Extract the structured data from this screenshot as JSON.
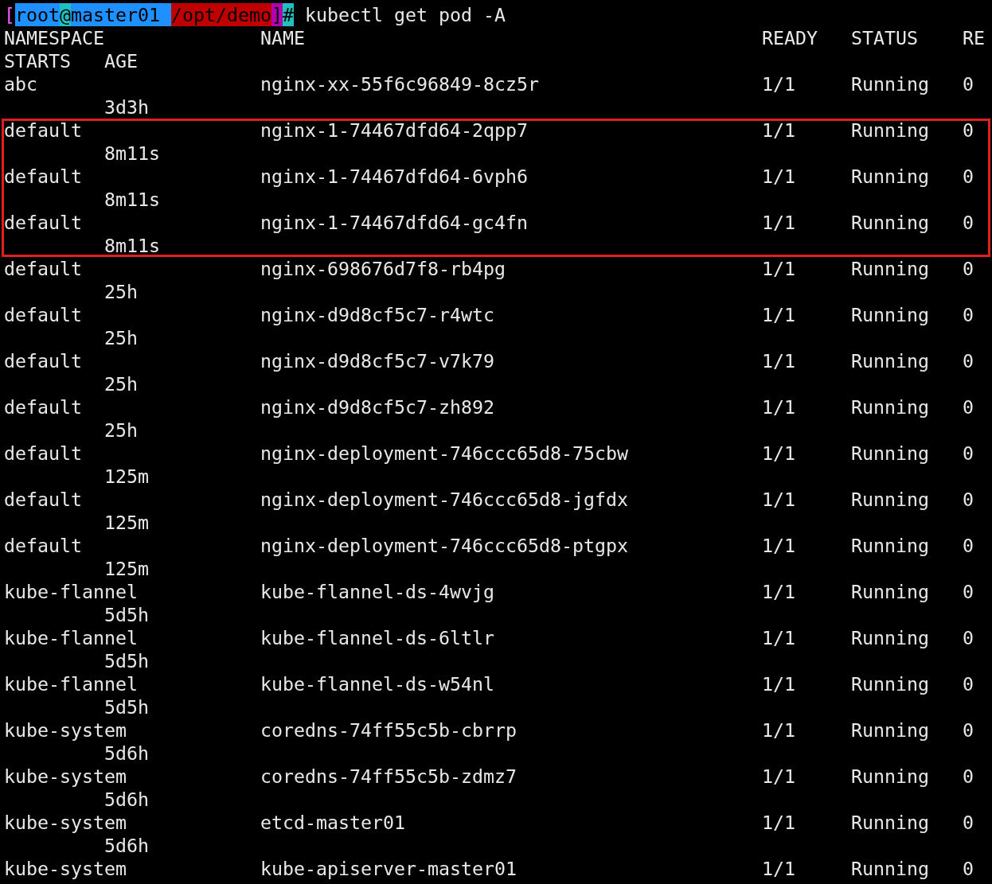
{
  "prompt": {
    "segments": [
      {
        "text": "[",
        "kind": "text",
        "color": "#ff55ff"
      },
      {
        "text": "root",
        "kind": "block",
        "color": "#1e90ff"
      },
      {
        "text": "@",
        "kind": "block",
        "color": "#20c0c0"
      },
      {
        "text": "master01 ",
        "kind": "block",
        "color": "#1e90ff"
      },
      {
        "text": "/opt/demo",
        "kind": "block",
        "color": "#c00000"
      },
      {
        "text": "]",
        "kind": "block",
        "color": "#b000b0"
      },
      {
        "text": "#",
        "kind": "block",
        "color": "#20c0c0"
      }
    ],
    "command": "kubectl get pod -A"
  },
  "table": {
    "columns": [
      "NAMESPACE",
      "NAME",
      "READY",
      "STATUS",
      "RE",
      "STARTS",
      "AGE"
    ],
    "rows": [
      {
        "namespace": "abc",
        "name": "nginx-xx-55f6c96849-8cz5r",
        "ready": "1/1",
        "status": "Running",
        "restarts": "0",
        "age": "3d3h",
        "highlighted": false
      },
      {
        "namespace": "default",
        "name": "nginx-1-74467dfd64-2qpp7",
        "ready": "1/1",
        "status": "Running",
        "restarts": "0",
        "age": "8m11s",
        "highlighted": true
      },
      {
        "namespace": "default",
        "name": "nginx-1-74467dfd64-6vph6",
        "ready": "1/1",
        "status": "Running",
        "restarts": "0",
        "age": "8m11s",
        "highlighted": true
      },
      {
        "namespace": "default",
        "name": "nginx-1-74467dfd64-gc4fn",
        "ready": "1/1",
        "status": "Running",
        "restarts": "0",
        "age": "8m11s",
        "highlighted": true
      },
      {
        "namespace": "default",
        "name": "nginx-698676d7f8-rb4pg",
        "ready": "1/1",
        "status": "Running",
        "restarts": "0",
        "age": "25h",
        "highlighted": false
      },
      {
        "namespace": "default",
        "name": "nginx-d9d8cf5c7-r4wtc",
        "ready": "1/1",
        "status": "Running",
        "restarts": "0",
        "age": "25h",
        "highlighted": false
      },
      {
        "namespace": "default",
        "name": "nginx-d9d8cf5c7-v7k79",
        "ready": "1/1",
        "status": "Running",
        "restarts": "0",
        "age": "25h",
        "highlighted": false
      },
      {
        "namespace": "default",
        "name": "nginx-d9d8cf5c7-zh892",
        "ready": "1/1",
        "status": "Running",
        "restarts": "0",
        "age": "25h",
        "highlighted": false
      },
      {
        "namespace": "default",
        "name": "nginx-deployment-746ccc65d8-75cbw",
        "ready": "1/1",
        "status": "Running",
        "restarts": "0",
        "age": "125m",
        "highlighted": false
      },
      {
        "namespace": "default",
        "name": "nginx-deployment-746ccc65d8-jgfdx",
        "ready": "1/1",
        "status": "Running",
        "restarts": "0",
        "age": "125m",
        "highlighted": false
      },
      {
        "namespace": "default",
        "name": "nginx-deployment-746ccc65d8-ptgpx",
        "ready": "1/1",
        "status": "Running",
        "restarts": "0",
        "age": "125m",
        "highlighted": false
      },
      {
        "namespace": "kube-flannel",
        "name": "kube-flannel-ds-4wvjg",
        "ready": "1/1",
        "status": "Running",
        "restarts": "0",
        "age": "5d5h",
        "highlighted": false
      },
      {
        "namespace": "kube-flannel",
        "name": "kube-flannel-ds-6ltlr",
        "ready": "1/1",
        "status": "Running",
        "restarts": "0",
        "age": "5d5h",
        "highlighted": false
      },
      {
        "namespace": "kube-flannel",
        "name": "kube-flannel-ds-w54nl",
        "ready": "1/1",
        "status": "Running",
        "restarts": "0",
        "age": "5d5h",
        "highlighted": false
      },
      {
        "namespace": "kube-system",
        "name": "coredns-74ff55c5b-cbrrp",
        "ready": "1/1",
        "status": "Running",
        "restarts": "0",
        "age": "5d6h",
        "highlighted": false
      },
      {
        "namespace": "kube-system",
        "name": "coredns-74ff55c5b-zdmz7",
        "ready": "1/1",
        "status": "Running",
        "restarts": "0",
        "age": "5d6h",
        "highlighted": false
      },
      {
        "namespace": "kube-system",
        "name": "etcd-master01",
        "ready": "1/1",
        "status": "Running",
        "restarts": "0",
        "age": "5d6h",
        "highlighted": false
      },
      {
        "namespace": "kube-system",
        "name": "kube-apiserver-master01",
        "ready": "1/1",
        "status": "Running",
        "restarts": "0",
        "highlighted": false
      }
    ]
  }
}
